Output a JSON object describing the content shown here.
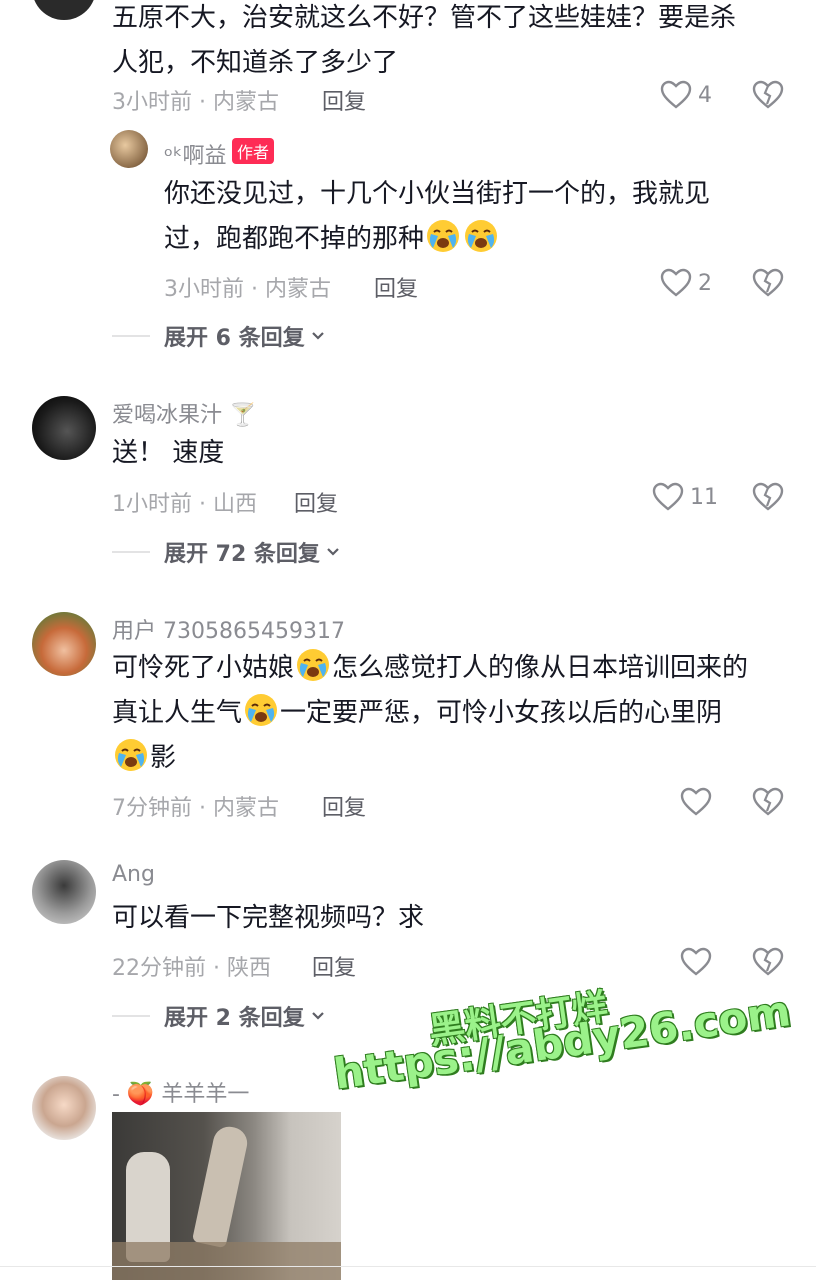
{
  "comments": [
    {
      "text_line1": "五原不大，治安就这么不好？管不了这些娃娃？要是杀",
      "text_line2": "人犯，不知道杀了多少了",
      "time_location": "3小时前 · 内蒙古",
      "reply_label": "回复",
      "likes": "4"
    },
    {
      "username": "ᵒᵏ啊益",
      "badge": "作者",
      "text_line1": "你还没见过，十几个小伙当街打一个的，我就见",
      "text_line2": "过，跑都跑不掉的那种",
      "time_location": "3小时前 · 内蒙古",
      "reply_label": "回复",
      "likes": "2",
      "expand": "展开 6 条回复"
    },
    {
      "username": "爱喝冰果汁 🍸",
      "text_line1": "送！ 速度",
      "time_location": "1小时前 · 山西",
      "reply_label": "回复",
      "likes": "11",
      "expand": "展开 72 条回复"
    },
    {
      "username": "用户 7305865459317",
      "text_line1a": "可怜死了小姑娘",
      "text_line1b": "怎么感觉打人的像从日本培训回来的",
      "text_line2a": "真让人生气",
      "text_line2b": "一定要严惩，可怜小女孩以后的心里阴",
      "text_line3": "影",
      "time_location": "7分钟前 · 内蒙古",
      "reply_label": "回复"
    },
    {
      "username": "Ang",
      "text_line1": "可以看一下完整视频吗？求",
      "time_location": "22分钟前 · 陕西",
      "reply_label": "回复",
      "expand": "展开 2 条回复"
    },
    {
      "username": "- 🍑 羊羊羊一"
    }
  ],
  "watermark": {
    "line1": "黑料不打烊",
    "line2": "https://abdy26.com"
  },
  "icons": {
    "like": "heart-outline-icon",
    "dislike": "broken-heart-icon",
    "chevron": "chevron-down-icon",
    "emoji_cry": "loudly-crying-face-icon"
  },
  "colors": {
    "badge": "#fe2c55",
    "text": "#161823",
    "meta": "#a6a7ab"
  }
}
